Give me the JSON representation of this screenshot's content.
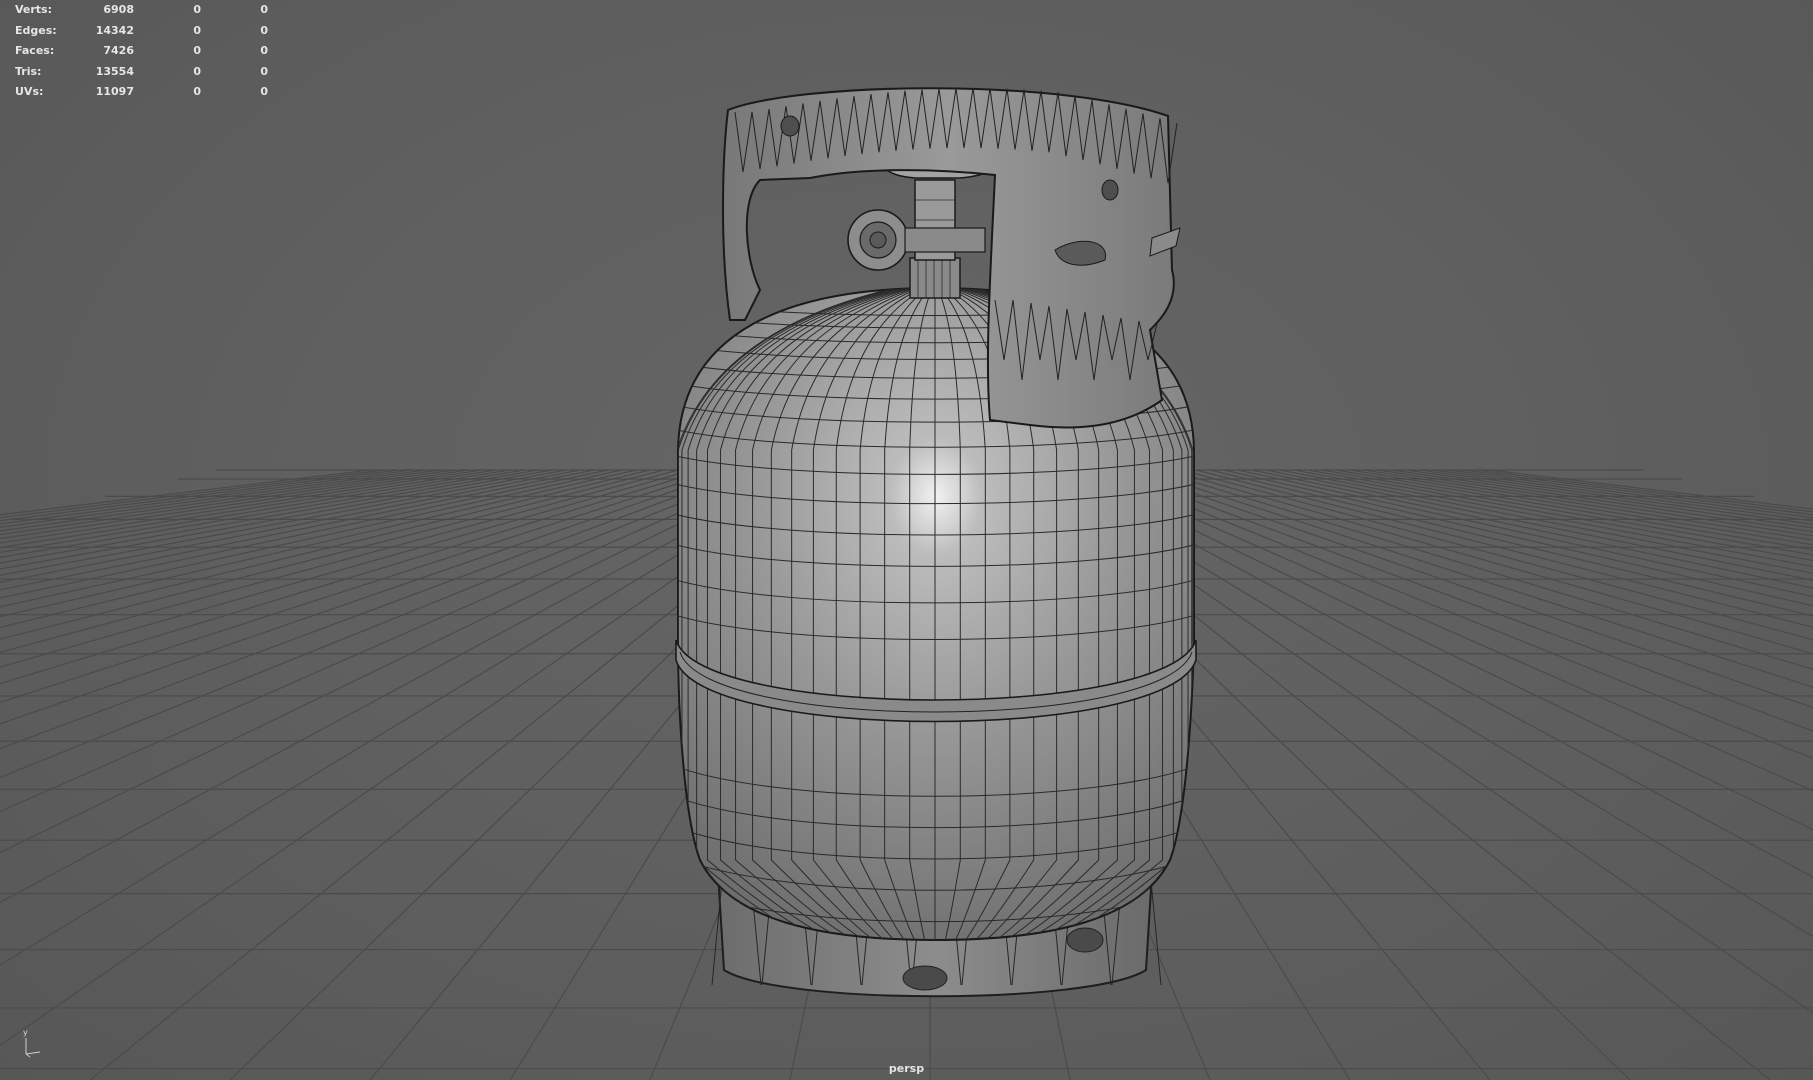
{
  "hud": {
    "rows": [
      {
        "label": "Verts:",
        "v1": "6908",
        "v2": "0",
        "v3": "0"
      },
      {
        "label": "Edges:",
        "v1": "14342",
        "v2": "0",
        "v3": "0"
      },
      {
        "label": "Faces:",
        "v1": "7426",
        "v2": "0",
        "v3": "0"
      },
      {
        "label": "Tris:",
        "v1": "13554",
        "v2": "0",
        "v3": "0"
      },
      {
        "label": "UVs:",
        "v1": "11097",
        "v2": "0",
        "v3": "0"
      }
    ]
  },
  "viewport": {
    "camera": "persp",
    "axis_label": "y",
    "background_color": "#5e5e5e",
    "grid_color": "#4a4a4a",
    "model": "gas-cylinder-wireframe"
  }
}
